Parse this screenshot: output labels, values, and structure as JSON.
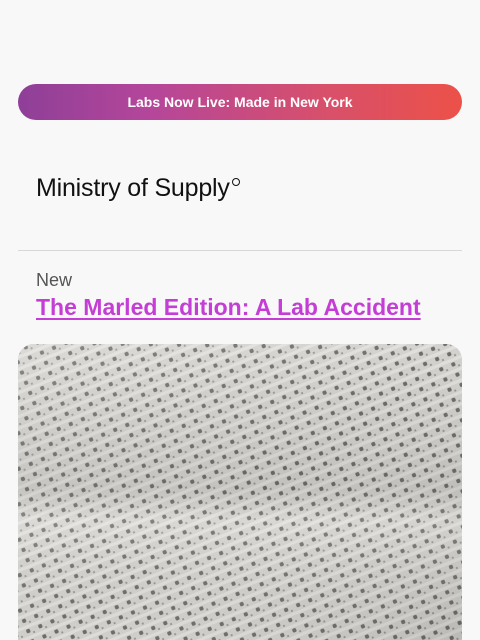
{
  "banner": {
    "text": "Labs Now Live: Made in New York",
    "gradient_start": "#8e3f98",
    "gradient_end": "#ec5148"
  },
  "brand": {
    "logo_text": "Ministry of Supply"
  },
  "article": {
    "eyebrow": "New",
    "headline": "The Marled Edition: A Lab Accident",
    "headline_color": "#c43ed6"
  },
  "hero_image": {
    "description_icon": "marled-knit-fabric-texture"
  }
}
